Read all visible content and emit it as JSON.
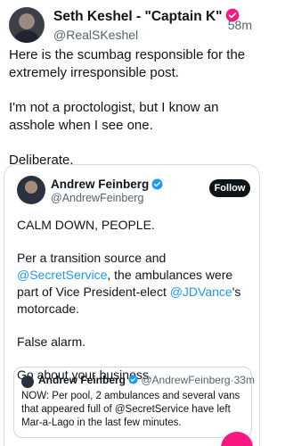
{
  "post": {
    "author_name": "Seth Keshel - \"Captain K\"",
    "author_handle": "@RealSKeshel",
    "timestamp": "58m",
    "paragraphs": [
      "Here is the scumbag responsible for the extremely irresponsible post.",
      "I'm not a proctologist, but I know an asshole when I see one.",
      "Deliberate."
    ]
  },
  "quoted": {
    "author_name": "Andrew Feinberg",
    "author_handle": "@AndrewFeinberg",
    "follow_label": "Follow",
    "p1": "CALM DOWN, PEOPLE.",
    "p2_a": "Per a transition source and ",
    "p2_link1": "@SecretService",
    "p2_b": ", the ambulances were part of Vice President-elect ",
    "p2_link2": "@JDVance",
    "p2_c": "'s motorcade.",
    "p3": "False alarm.",
    "p4": "Go about your business.",
    "nested": {
      "author_name": "Andrew Feinberg",
      "author_handle": "@AndrewFeinberg",
      "separator": "·",
      "time": "33m",
      "text": "NOW: Per pool,  2 ambulances and several vans that appeared full of @SecretService have left Mar-a-Lago in the last few minutes."
    }
  },
  "colors": {
    "verified": "#f91880",
    "verified_blue": "#1d9bf0",
    "link": "#1d9bf0"
  },
  "icons": {
    "verified_author": "verified-badge-icon",
    "verified_quoted": "verified-badge-icon"
  }
}
